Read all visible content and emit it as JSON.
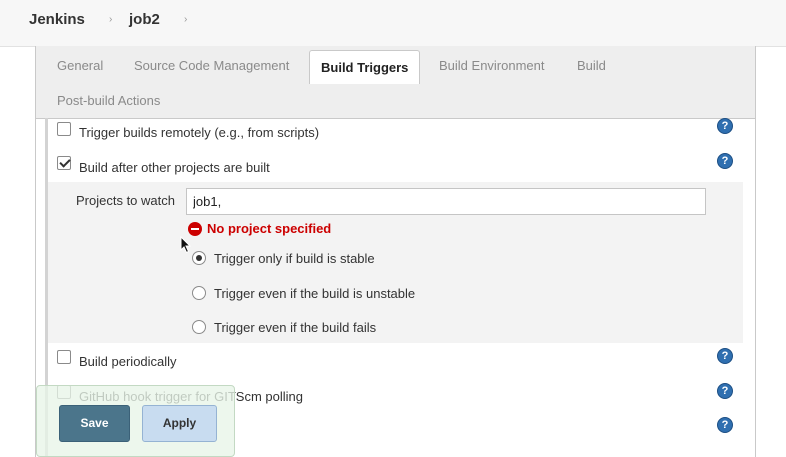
{
  "breadcrumb": {
    "items": [
      "Jenkins",
      "job2"
    ],
    "separator": "›"
  },
  "tabs": {
    "general": "General",
    "scm": "Source Code Management",
    "build_triggers": "Build Triggers",
    "build_environment": "Build Environment",
    "build": "Build",
    "post_build": "Post-build Actions",
    "active": "Build Triggers"
  },
  "triggers": {
    "remote": {
      "label": "Trigger builds remotely (e.g., from scripts)",
      "checked": false
    },
    "after_other": {
      "label": "Build after other projects are built",
      "checked": true
    },
    "periodically": {
      "label": "Build periodically",
      "checked": false
    },
    "github_hook": {
      "label": "GitHub hook trigger for GITScm polling",
      "checked": false
    }
  },
  "after_other_config": {
    "projects_label": "Projects to watch",
    "projects_value": "job1,",
    "error": "No project specified",
    "options": [
      {
        "label": "Trigger only if build is stable",
        "selected": true
      },
      {
        "label": "Trigger even if the build is unstable",
        "selected": false
      },
      {
        "label": "Trigger even if the build fails",
        "selected": false
      }
    ]
  },
  "help_icon_text": "?",
  "buttons": {
    "save": "Save",
    "apply": "Apply"
  },
  "colors": {
    "error": "#cc0000",
    "help": "#2f6fb0",
    "save_button": "#4b758b",
    "apply_button": "#c8dcf0"
  }
}
